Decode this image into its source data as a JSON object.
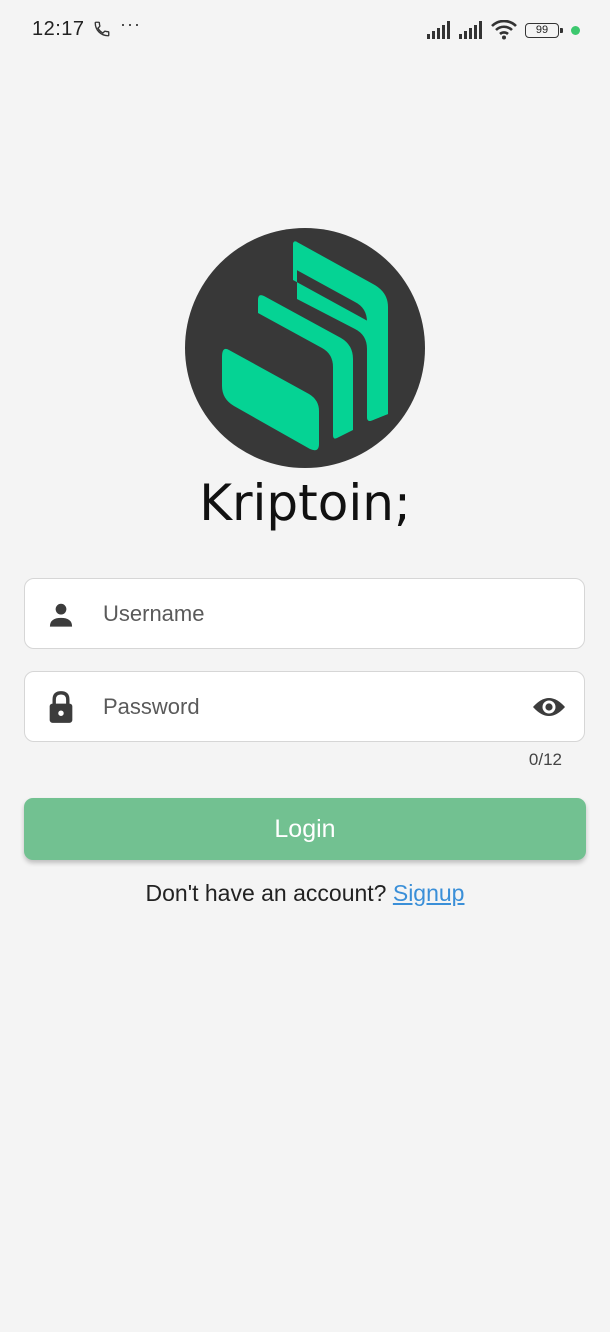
{
  "status_bar": {
    "time": "12:17",
    "more": "···",
    "battery": "99",
    "phone_icon": "phone-icon",
    "signal_icon": "signal-bars-icon",
    "wifi_icon": "wifi-icon",
    "dot_color": "#3cc86e"
  },
  "logo": {
    "icon": "compound-logo-icon",
    "circle_color": "#383838",
    "mark_color": "#05d394"
  },
  "app_title": "Kriptoin;",
  "form": {
    "username": {
      "placeholder": "Username",
      "value": "",
      "icon": "person-icon"
    },
    "password": {
      "placeholder": "Password",
      "value": "",
      "icon": "lock-icon",
      "toggle_icon": "eye-icon",
      "counter": "0/12"
    },
    "login_label": "Login",
    "login_color": "#72c191"
  },
  "signup": {
    "prompt": "Don't have an account? ",
    "link": "Signup"
  }
}
